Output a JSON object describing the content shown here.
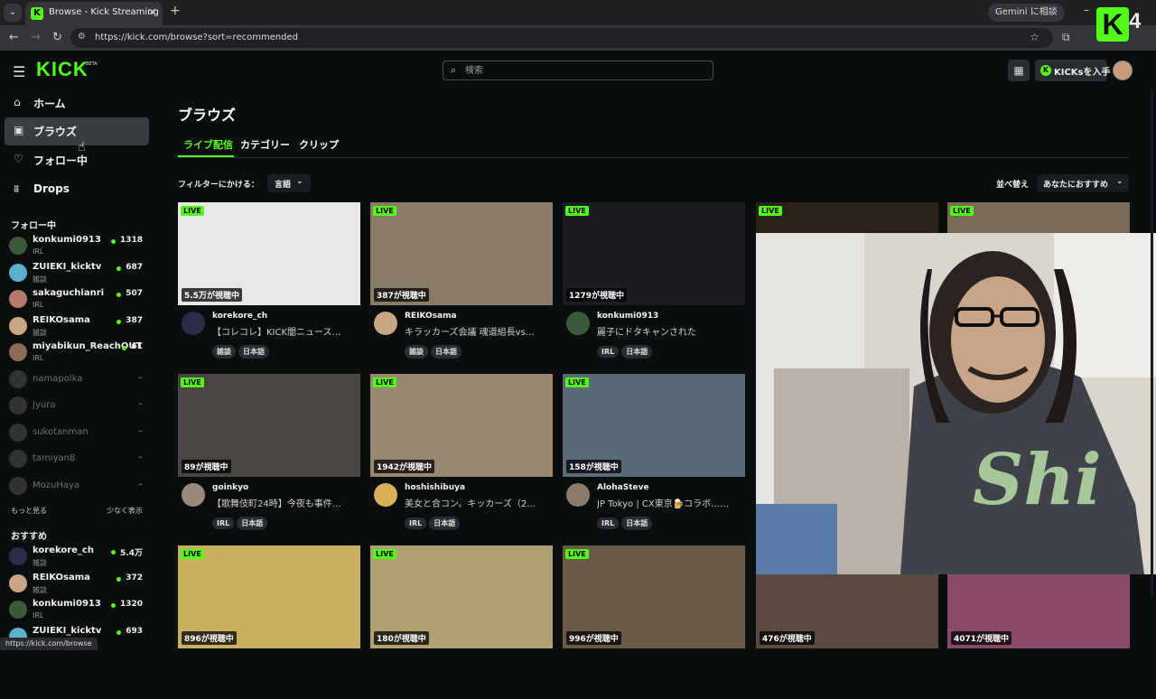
{
  "browser": {
    "tab_title": "Browse - Kick Streaming",
    "tab_close": "✕",
    "new_tab": "+",
    "url": "https://kick.com/browse?sort=recommended",
    "gemini_label": "Gemini に相談",
    "status_url": "https://kick.com/browse"
  },
  "overlay": {
    "logo_letter": "K",
    "number": "4"
  },
  "header": {
    "logo": "KICK",
    "logo_beta": "BETA",
    "search_placeholder": "検索",
    "kicks_button": "KICKsを入手",
    "kicks_icon": "K"
  },
  "sidebar": {
    "nav": [
      {
        "label": "ホーム",
        "icon": "home-icon"
      },
      {
        "label": "ブラウズ",
        "icon": "browse-icon"
      },
      {
        "label": "フォロー中",
        "icon": "heart-icon"
      },
      {
        "label": "Drops",
        "icon": "drops-icon"
      }
    ],
    "following_title": "フォロー中",
    "following": [
      {
        "name": "konkumi0913",
        "category": "IRL",
        "viewers": "1318",
        "live": true,
        "color": "#3a5a3a"
      },
      {
        "name": "ZUIEKI_kicktv",
        "category": "雑談",
        "viewers": "687",
        "live": true,
        "color": "#5ab0c8"
      },
      {
        "name": "sakaguchianri",
        "category": "IRL",
        "viewers": "507",
        "live": true,
        "color": "#b57a6b"
      },
      {
        "name": "REIKOsama",
        "category": "雑談",
        "viewers": "387",
        "live": true,
        "color": "#c9a583"
      },
      {
        "name": "miyabikun_ReachOUT",
        "category": "IRL",
        "viewers": "61",
        "live": true,
        "color": "#8c6a55"
      },
      {
        "name": "namapolka",
        "live": false,
        "color": "#777"
      },
      {
        "name": "Jyura",
        "live": false,
        "color": "#777"
      },
      {
        "name": "sukotanman",
        "live": false,
        "color": "#777"
      },
      {
        "name": "tamiyan8",
        "live": false,
        "color": "#777"
      },
      {
        "name": "MozuHaya",
        "live": false,
        "color": "#777"
      }
    ],
    "show_more": "もっと見る",
    "show_less": "少なく表示",
    "recommended_title": "おすすめ",
    "recommended": [
      {
        "name": "korekore_ch",
        "category": "雑談",
        "viewers": "5.4万",
        "color": "#2c2c4a"
      },
      {
        "name": "REIKOsama",
        "category": "雑談",
        "viewers": "372",
        "color": "#c9a583"
      },
      {
        "name": "konkumi0913",
        "category": "IRL",
        "viewers": "1320",
        "color": "#3a5a3a"
      },
      {
        "name": "ZUIEKI_kicktv",
        "category": "",
        "viewers": "693",
        "color": "#5ab0c8"
      }
    ]
  },
  "main": {
    "title": "ブラウズ",
    "tabs": [
      "ライブ配信",
      "カテゴリー",
      "クリップ"
    ],
    "filter_label": "フィルターにかける：",
    "filter_value": "言語",
    "sort_label": "並べ替え",
    "sort_value": "あなたにおすすめ",
    "live_label": "LIVE",
    "cards": [
      {
        "channel": "korekore_ch",
        "title": "【コレコレ】KICK闇ニュース…",
        "viewers": "5.5万が視聴中",
        "tags": [
          "雑談",
          "日本語"
        ],
        "thumb": "#e8e8e8",
        "avatar": "#2c2c4a"
      },
      {
        "channel": "REIKOsama",
        "title": "キラッカーズ会議 魂道組長vs…",
        "viewers": "387が視聴中",
        "tags": [
          "雑談",
          "日本語"
        ],
        "thumb": "#8a7b68",
        "avatar": "#c9a583"
      },
      {
        "channel": "konkumi0913",
        "title": "麗子にドタキャンされた",
        "viewers": "1279が視聴中",
        "tags": [
          "IRL",
          "日本語"
        ],
        "thumb": "#1a1c22",
        "avatar": "#3a5a3a"
      },
      {
        "channel": "",
        "title": "",
        "viewers": "",
        "tags": [],
        "thumb": "#2a2218",
        "avatar": "#555"
      },
      {
        "channel": "",
        "title": "",
        "viewers": "",
        "tags": [],
        "thumb": "#7a6a55",
        "avatar": "#555"
      },
      {
        "channel": "goinkyo",
        "title": "【歌舞伎町24時】今夜も事件…",
        "viewers": "89が視聴中",
        "tags": [
          "IRL",
          "日本語"
        ],
        "thumb": "#4a4540",
        "avatar": "#9a8a7a"
      },
      {
        "channel": "hoshishibuya",
        "title": "美女と合コン。キッカーズ（2…",
        "viewers": "1942が視聴中",
        "tags": [
          "IRL",
          "日本語"
        ],
        "thumb": "#9a8770",
        "avatar": "#d8b05a"
      },
      {
        "channel": "AlohaSteve",
        "title": "JP Tokyo | CX東京🍺コラボ……",
        "viewers": "158が視聴中",
        "tags": [
          "IRL",
          "日本語"
        ],
        "thumb": "#5a6a7a",
        "avatar": "#8a7a6a"
      },
      {
        "channel": "",
        "title": "",
        "viewers": "",
        "tags": [],
        "thumb": "#444",
        "avatar": "#555"
      },
      {
        "channel": "",
        "title": "",
        "viewers": "",
        "tags": [],
        "thumb": "#444",
        "avatar": "#555"
      },
      {
        "channel": "",
        "title": "",
        "viewers": "896が視聴中",
        "tags": [],
        "thumb": "#c8b060",
        "avatar": "#555"
      },
      {
        "channel": "",
        "title": "",
        "viewers": "180が視聴中",
        "tags": [],
        "thumb": "#b0a070",
        "avatar": "#555"
      },
      {
        "channel": "",
        "title": "",
        "viewers": "996が視聴中",
        "tags": [],
        "thumb": "#6a5a48",
        "avatar": "#555"
      },
      {
        "channel": "",
        "title": "",
        "viewers": "476が視聴中",
        "tags": [],
        "thumb": "#5a4a40",
        "avatar": "#555"
      },
      {
        "channel": "",
        "title": "",
        "viewers": "4071が視聴中",
        "tags": [],
        "thumb": "#8a4a6a",
        "avatar": "#555"
      }
    ]
  },
  "webcam": {
    "shirt_text": "Shi"
  },
  "colors": {
    "accent": "#53fc18",
    "bg": "#0b0e0f"
  }
}
